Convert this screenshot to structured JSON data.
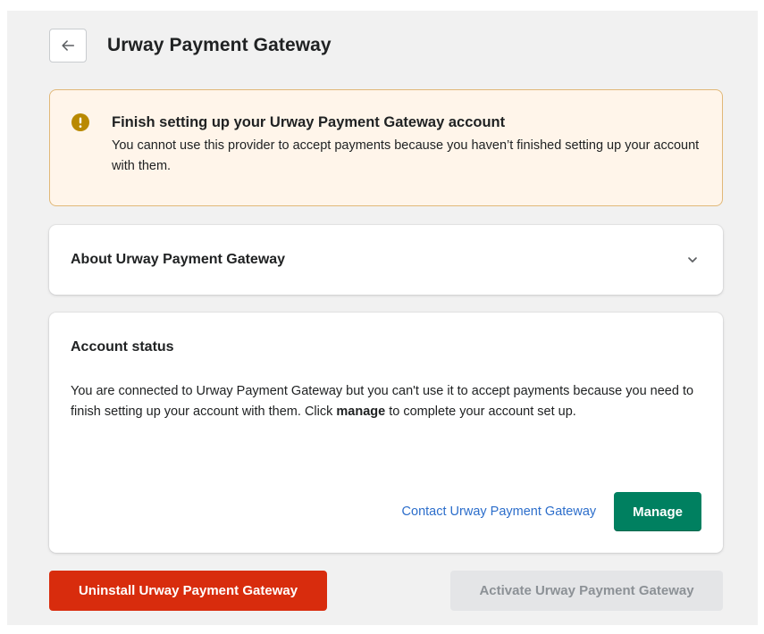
{
  "header": {
    "title": "Urway Payment Gateway",
    "back_icon": "arrow-left-icon"
  },
  "banner": {
    "icon": "alert-circle-icon",
    "title": "Finish setting up your Urway Payment Gateway account",
    "text": "You cannot use this provider to accept payments because you haven’t finished setting up your account with them.",
    "color_bg": "#fff5ea",
    "color_icon": "#b98900"
  },
  "about": {
    "title": "About Urway Payment Gateway",
    "icon": "chevron-down-icon"
  },
  "account_status": {
    "title": "Account status",
    "text_before": "You are connected to Urway Payment Gateway but you can't use it to accept payments because you need to finish setting up your account with them. Click ",
    "text_bold": "manage",
    "text_after": " to complete your account set up.",
    "contact_link": "Contact Urway Payment Gateway",
    "manage_label": "Manage",
    "color_primary": "#008060"
  },
  "footer": {
    "uninstall_label": "Uninstall Urway Payment Gateway",
    "activate_label": "Activate Urway Payment Gateway",
    "color_destructive": "#d82c0d"
  }
}
